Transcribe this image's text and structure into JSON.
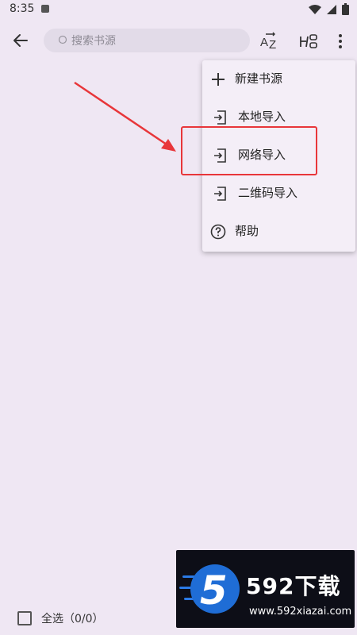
{
  "status_bar": {
    "time": "8:35"
  },
  "search": {
    "placeholder": "搜索书源"
  },
  "menu": {
    "items": [
      {
        "label": "新建书源",
        "icon": "plus-icon"
      },
      {
        "label": "本地导入",
        "icon": "import-icon"
      },
      {
        "label": "网络导入",
        "icon": "import-icon"
      },
      {
        "label": "二维码导入",
        "icon": "import-icon"
      },
      {
        "label": "帮助",
        "icon": "help-icon"
      }
    ]
  },
  "bottom_bar": {
    "select_all_label": "全选（0/0）"
  },
  "watermark": {
    "brand": "592下载",
    "url": "www.592xiazai.com"
  },
  "colors": {
    "background": "#efe7f3",
    "menu_bg": "#f4eef7",
    "highlight": "#e8363a",
    "watermark_bg": "#0d0e17"
  }
}
